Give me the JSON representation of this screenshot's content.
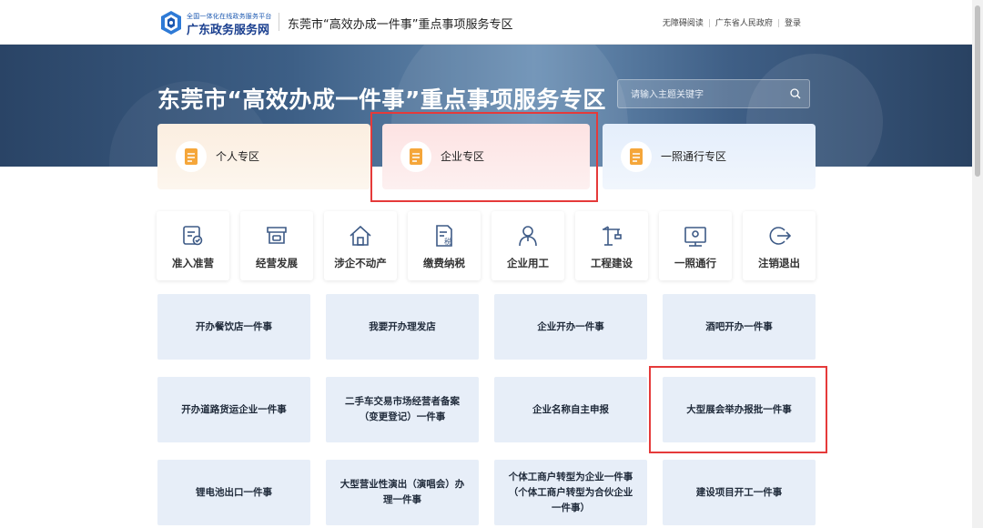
{
  "header": {
    "platform_small": "全国一体化在线政务服务平台",
    "platform_name": "广东政务服务网",
    "zone_title": "东莞市“高效办成一件事”重点事项服务专区",
    "links": [
      "无障碍阅读",
      "广东省人民政府",
      "登录"
    ]
  },
  "banner": {
    "title": "东莞市“高效办成一件事”重点事项服务专区",
    "search_placeholder": "请输入主题关键字"
  },
  "zones": [
    {
      "label": "个人专区",
      "icon": "document-icon"
    },
    {
      "label": "企业专区",
      "icon": "document-icon"
    },
    {
      "label": "一照通行专区",
      "icon": "document-icon"
    }
  ],
  "categories": [
    {
      "label": "准入准营",
      "icon": "license-check-icon"
    },
    {
      "label": "经营发展",
      "icon": "storefront-icon"
    },
    {
      "label": "涉企不动产",
      "icon": "house-icon"
    },
    {
      "label": "缴费纳税",
      "icon": "tax-document-icon"
    },
    {
      "label": "企业用工",
      "icon": "worker-icon"
    },
    {
      "label": "工程建设",
      "icon": "crane-icon"
    },
    {
      "label": "一照通行",
      "icon": "certificate-icon"
    },
    {
      "label": "注销退出",
      "icon": "exit-icon"
    }
  ],
  "services": [
    "开办餐饮店一件事",
    "我要开办理发店",
    "企业开办一件事",
    "酒吧开办一件事",
    "开办道路货运企业一件事",
    "二手车交易市场经营者备案（变更登记）一件事",
    "企业名称自主申报",
    "大型展会举办报批一件事",
    "锂电池出口一件事",
    "大型营业性演出（演唱会）办理一件事",
    "个体工商户转型为企业一件事（个体工商户转型为合伙企业一件事）",
    "建设项目开工一件事"
  ],
  "colors": {
    "brand_blue": "#1a57b0",
    "highlight_red": "#e53a3a",
    "card_bg": "#e7eef8"
  }
}
